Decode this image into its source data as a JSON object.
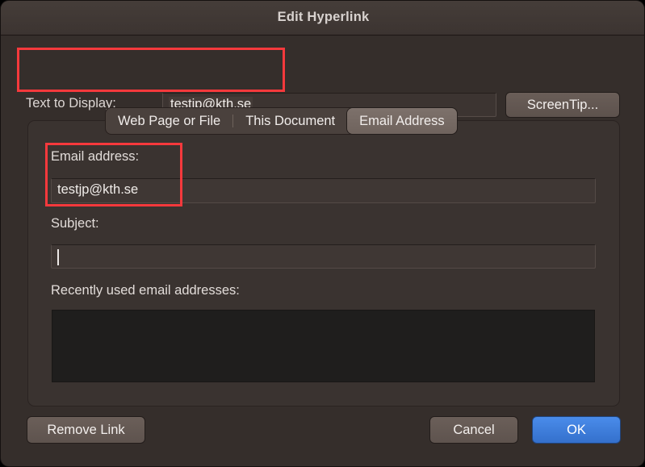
{
  "window": {
    "title": "Edit Hyperlink",
    "background_color": "#352e2b",
    "panel_color": "#3a3330"
  },
  "top_row": {
    "text_to_display_label": "Text to Display:",
    "text_to_display_value": "testjp@kth.se",
    "screentip_button_label": "ScreenTip..."
  },
  "tabs": [
    {
      "label": "Web Page or File",
      "selected": false
    },
    {
      "label": "This Document",
      "selected": false
    },
    {
      "label": "Email Address",
      "selected": true
    }
  ],
  "panel": {
    "email_address_label": "Email address:",
    "email_address_value": "testjp@kth.se",
    "subject_label": "Subject:",
    "subject_value": "",
    "recent_label": "Recently used email addresses:",
    "recent_items": []
  },
  "buttons": {
    "remove_link": "Remove Link",
    "cancel": "Cancel",
    "ok": "OK",
    "ok_color": "#3d7fe0"
  },
  "annotations": {
    "color": "#f6393c",
    "boxes": [
      {
        "name": "text-to-display-highlight"
      },
      {
        "name": "email-address-highlight"
      }
    ]
  }
}
